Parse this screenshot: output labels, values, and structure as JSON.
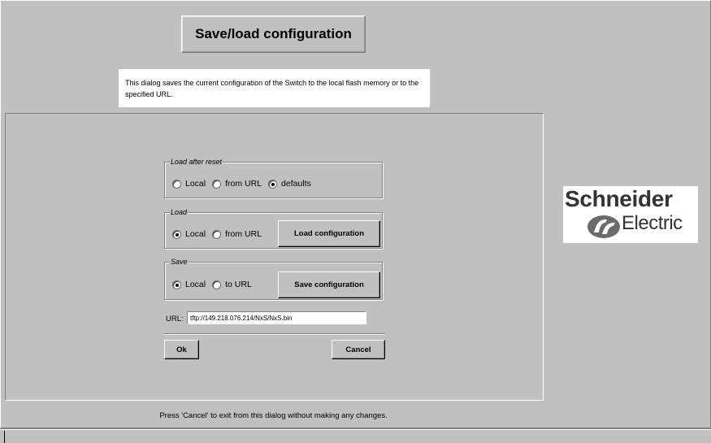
{
  "dialog": {
    "title": "Save/load configuration",
    "description": "This dialog saves the current configuration of the Switch to the local flash memory or to the specified URL."
  },
  "load_after_reset": {
    "legend": "Load after reset",
    "options": [
      "Local",
      "from URL",
      "defaults"
    ],
    "selected": "defaults"
  },
  "load": {
    "legend": "Load",
    "options": [
      "Local",
      "from URL"
    ],
    "selected": "Local",
    "button_label": "Load configuration"
  },
  "save": {
    "legend": "Save",
    "options": [
      "Local",
      "to URL"
    ],
    "selected": "Local",
    "button_label": "Save configuration"
  },
  "url": {
    "label": "URL:",
    "value": "tftp://149.218.076.214/NxS/NxS.bin"
  },
  "buttons": {
    "ok": "Ok",
    "cancel": "Cancel"
  },
  "footer": {
    "hint": "Press 'Cancel' to exit from this dialog without making any changes."
  },
  "logo": {
    "line1": "Schneider",
    "line2": "Electric",
    "icon": "schneider-electric-logo"
  }
}
